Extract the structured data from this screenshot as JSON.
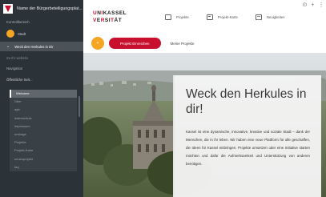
{
  "sidebar": {
    "title": "Name der Bürgerbeteiligungsplat...",
    "section_kontroll": "Kontrollbereich",
    "item_stadt": "Stadt",
    "item_active": "Weck den Herkules in Dir",
    "item_website": "Zu Ihr website",
    "section_navigation": "Navigation",
    "item_public": "Öffentliche Seit...",
    "subitems": [
      "Welcome",
      "Über",
      "agb",
      "datenschutz",
      "impressum",
      "umfrage",
      "Projekte",
      "Projekt-Karte",
      "neuesprojekt",
      "faq"
    ]
  },
  "header": {
    "uni_line1": [
      "U",
      "N",
      "I",
      "K",
      "A",
      "S",
      "S",
      "E",
      "L"
    ],
    "uni_line2": [
      "V",
      "E",
      "R",
      "S",
      "I",
      "T",
      "Ä",
      "T"
    ],
    "toolbar_icons": [
      "⊙",
      "+",
      "⋮"
    ],
    "nav": [
      {
        "label": "Projekte",
        "icon": "folder-icon"
      },
      {
        "label": "Projekt-Karte",
        "icon": "map-icon"
      },
      {
        "label": "Neuigkeiten",
        "icon": "news-icon"
      }
    ]
  },
  "actions": {
    "circle_label": "+",
    "primary_label": "Projekt Einreichen",
    "secondary_label": "Meine Projekte"
  },
  "hero": {
    "title": "Weck den Herkules in dir!",
    "text": "Kassel ist eine dynamische, innovative, kreative und soziale Stadt – dank der Menschen, die in ihr leben. Wir haben eine neue Plattform für alle geschaffen, die Ideen für Kassel einbringen. Projekte umsetzen oder eine Initiative starten möchten und dafür die Aufmerksamkeit und Unterstützung von anderen benötigen."
  },
  "colors": {
    "sidebar_bg": "#2c3338",
    "accent_red": "#c8102e",
    "accent_orange": "#f5a623"
  }
}
